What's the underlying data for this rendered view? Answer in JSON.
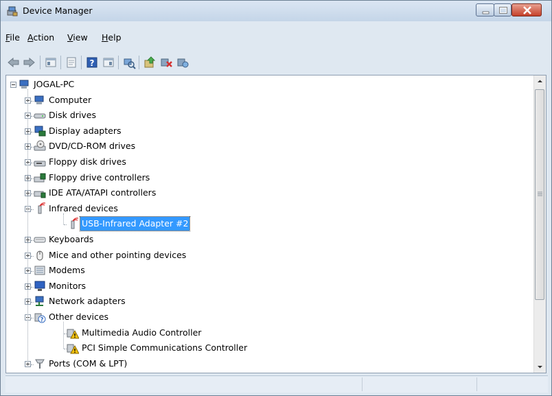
{
  "window": {
    "title": "Device Manager",
    "title_icon": "device-manager-icon",
    "controls": [
      "minimize-icon",
      "maximize-icon",
      "close-icon"
    ]
  },
  "menu": [
    {
      "label": "File",
      "mnemonic": "F",
      "rest": "ile"
    },
    {
      "label": "Action",
      "mnemonic": "A",
      "rest": "ction"
    },
    {
      "label": "View",
      "mnemonic": "V",
      "rest": "iew"
    },
    {
      "label": "Help",
      "mnemonic": "H",
      "rest": "elp"
    }
  ],
  "toolbar": [
    "back-icon",
    "forward-icon",
    "show-hide-console-tree-icon",
    "properties-icon",
    "help-icon",
    "show-hide-action-pane-icon",
    "scan-hardware-icon",
    "update-driver-icon",
    "disable-device-icon",
    "uninstall-device-icon"
  ],
  "tree": {
    "root": {
      "label": "JOGAL-PC",
      "icon": "computer-icon",
      "expanded": true
    },
    "nodes": [
      {
        "label": "Computer",
        "icon": "computer-icon",
        "level": 1,
        "expander": "plus"
      },
      {
        "label": "Disk drives",
        "icon": "disk-drive-icon",
        "level": 1,
        "expander": "plus"
      },
      {
        "label": "Display adapters",
        "icon": "display-adapter-icon",
        "level": 1,
        "expander": "plus"
      },
      {
        "label": "DVD/CD-ROM drives",
        "icon": "dvd-drive-icon",
        "level": 1,
        "expander": "plus"
      },
      {
        "label": "Floppy disk drives",
        "icon": "floppy-drive-icon",
        "level": 1,
        "expander": "plus"
      },
      {
        "label": "Floppy drive controllers",
        "icon": "floppy-controller-icon",
        "level": 1,
        "expander": "plus"
      },
      {
        "label": "IDE ATA/ATAPI controllers",
        "icon": "ide-controller-icon",
        "level": 1,
        "expander": "plus"
      },
      {
        "label": "Infrared devices",
        "icon": "infrared-icon",
        "level": 1,
        "expander": "minus"
      },
      {
        "label": "USB-Infrared Adapter #2",
        "icon": "infrared-icon",
        "level": 2,
        "expander": "none",
        "selected": true
      },
      {
        "label": "Keyboards",
        "icon": "keyboard-icon",
        "level": 1,
        "expander": "plus"
      },
      {
        "label": "Mice and other pointing devices",
        "icon": "mouse-icon",
        "level": 1,
        "expander": "plus"
      },
      {
        "label": "Modems",
        "icon": "modem-icon",
        "level": 1,
        "expander": "plus"
      },
      {
        "label": "Monitors",
        "icon": "monitor-icon",
        "level": 1,
        "expander": "plus"
      },
      {
        "label": "Network adapters",
        "icon": "network-adapter-icon",
        "level": 1,
        "expander": "plus"
      },
      {
        "label": "Other devices",
        "icon": "unknown-device-icon",
        "level": 1,
        "expander": "minus"
      },
      {
        "label": "Multimedia Audio Controller",
        "icon": "warning-device-icon",
        "level": 2,
        "expander": "none"
      },
      {
        "label": "PCI Simple Communications Controller",
        "icon": "warning-device-icon",
        "level": 2,
        "expander": "none"
      },
      {
        "label": "Ports (COM & LPT)",
        "icon": "port-icon",
        "level": 1,
        "expander": "plus"
      }
    ]
  },
  "colors": {
    "selection": "#3399ff",
    "title_bar": "#c4d5e8",
    "window_frame": "#dfe8f1"
  }
}
